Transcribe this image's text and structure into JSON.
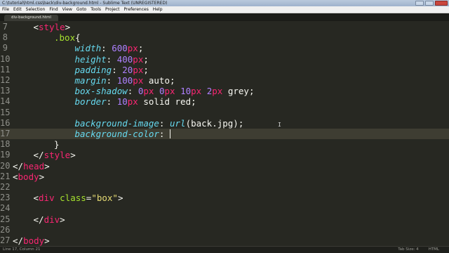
{
  "window": {
    "title": "C:\\tutorial\\html.css\\back\\div-background.html - Sublime Text (UNREGISTERED)"
  },
  "menu": [
    "File",
    "Edit",
    "Selection",
    "Find",
    "View",
    "Goto",
    "Tools",
    "Project",
    "Preferences",
    "Help"
  ],
  "tab": {
    "label": "div-background.html"
  },
  "code": {
    "lines": [
      {
        "num": "7",
        "indent": 1,
        "tokens": [
          {
            "t": "<",
            "c": "punc"
          },
          {
            "t": "style",
            "c": "tag"
          },
          {
            "t": ">",
            "c": "punc"
          }
        ]
      },
      {
        "num": "8",
        "indent": 2,
        "tokens": [
          {
            "t": ".box",
            "c": "sel"
          },
          {
            "t": "{",
            "c": "punc"
          }
        ]
      },
      {
        "num": "9",
        "indent": 3,
        "tokens": [
          {
            "t": "width",
            "c": "prop"
          },
          {
            "t": ": ",
            "c": "punc"
          },
          {
            "t": "600",
            "c": "num"
          },
          {
            "t": "px",
            "c": "unit"
          },
          {
            "t": ";",
            "c": "punc"
          }
        ]
      },
      {
        "num": "10",
        "indent": 3,
        "tokens": [
          {
            "t": "height",
            "c": "prop"
          },
          {
            "t": ": ",
            "c": "punc"
          },
          {
            "t": "400",
            "c": "num"
          },
          {
            "t": "px",
            "c": "unit"
          },
          {
            "t": ";",
            "c": "punc"
          }
        ]
      },
      {
        "num": "11",
        "indent": 3,
        "tokens": [
          {
            "t": "padding",
            "c": "prop"
          },
          {
            "t": ": ",
            "c": "punc"
          },
          {
            "t": "20",
            "c": "num"
          },
          {
            "t": "px",
            "c": "unit"
          },
          {
            "t": ";",
            "c": "punc"
          }
        ]
      },
      {
        "num": "12",
        "indent": 3,
        "tokens": [
          {
            "t": "margin",
            "c": "prop"
          },
          {
            "t": ": ",
            "c": "punc"
          },
          {
            "t": "100",
            "c": "num"
          },
          {
            "t": "px",
            "c": "unit"
          },
          {
            "t": " auto;",
            "c": "plain"
          }
        ]
      },
      {
        "num": "13",
        "indent": 3,
        "tokens": [
          {
            "t": "box-shadow",
            "c": "prop"
          },
          {
            "t": ": ",
            "c": "punc"
          },
          {
            "t": "0",
            "c": "num"
          },
          {
            "t": "px",
            "c": "unit"
          },
          {
            "t": " ",
            "c": "punc"
          },
          {
            "t": "0",
            "c": "num"
          },
          {
            "t": "px",
            "c": "unit"
          },
          {
            "t": " ",
            "c": "punc"
          },
          {
            "t": "10",
            "c": "num"
          },
          {
            "t": "px",
            "c": "unit"
          },
          {
            "t": " ",
            "c": "punc"
          },
          {
            "t": "2",
            "c": "num"
          },
          {
            "t": "px",
            "c": "unit"
          },
          {
            "t": " grey;",
            "c": "plain"
          }
        ]
      },
      {
        "num": "14",
        "indent": 3,
        "tokens": [
          {
            "t": "border",
            "c": "prop"
          },
          {
            "t": ": ",
            "c": "punc"
          },
          {
            "t": "10",
            "c": "num"
          },
          {
            "t": "px",
            "c": "unit"
          },
          {
            "t": " solid red;",
            "c": "plain"
          }
        ]
      },
      {
        "num": "15",
        "indent": 0,
        "tokens": []
      },
      {
        "num": "16",
        "indent": 3,
        "tokens": [
          {
            "t": "background-image",
            "c": "prop"
          },
          {
            "t": ": ",
            "c": "punc"
          },
          {
            "t": "url",
            "c": "prop"
          },
          {
            "t": "(back.jpg);",
            "c": "plain"
          }
        ]
      },
      {
        "num": "17",
        "indent": 3,
        "current": true,
        "caret": true,
        "tokens": [
          {
            "t": "background-color",
            "c": "prop"
          },
          {
            "t": ": ",
            "c": "punc"
          }
        ]
      },
      {
        "num": "18",
        "indent": 2,
        "tokens": [
          {
            "t": "}",
            "c": "punc"
          }
        ]
      },
      {
        "num": "19",
        "indent": 1,
        "tokens": [
          {
            "t": "</",
            "c": "punc"
          },
          {
            "t": "style",
            "c": "tag"
          },
          {
            "t": ">",
            "c": "punc"
          }
        ]
      },
      {
        "num": "20",
        "indent": 0,
        "tokens": [
          {
            "t": "</",
            "c": "punc"
          },
          {
            "t": "head",
            "c": "tag"
          },
          {
            "t": ">",
            "c": "punc"
          }
        ]
      },
      {
        "num": "21",
        "indent": 0,
        "tokens": [
          {
            "t": "<",
            "c": "punc"
          },
          {
            "t": "body",
            "c": "tag"
          },
          {
            "t": ">",
            "c": "punc"
          }
        ]
      },
      {
        "num": "22",
        "indent": 0,
        "tokens": []
      },
      {
        "num": "23",
        "indent": 1,
        "tokens": [
          {
            "t": "<",
            "c": "punc"
          },
          {
            "t": "div",
            "c": "tag"
          },
          {
            "t": " ",
            "c": "punc"
          },
          {
            "t": "class",
            "c": "attr"
          },
          {
            "t": "=",
            "c": "punc"
          },
          {
            "t": "\"box\"",
            "c": "str"
          },
          {
            "t": ">",
            "c": "punc"
          }
        ]
      },
      {
        "num": "24",
        "indent": 0,
        "tokens": []
      },
      {
        "num": "25",
        "indent": 1,
        "tokens": [
          {
            "t": "</",
            "c": "punc"
          },
          {
            "t": "div",
            "c": "tag"
          },
          {
            "t": ">",
            "c": "punc"
          }
        ]
      },
      {
        "num": "26",
        "indent": 0,
        "tokens": []
      },
      {
        "num": "27",
        "indent": 0,
        "tokens": [
          {
            "t": "</",
            "c": "punc"
          },
          {
            "t": "body",
            "c": "tag"
          },
          {
            "t": ">",
            "c": "punc"
          }
        ]
      }
    ]
  },
  "status": {
    "position": "Line 17, Column 21",
    "tab_size": "Tab Size: 4",
    "syntax": "HTML"
  },
  "colors": {
    "background": "#272822",
    "tag": "#f92672",
    "property": "#66d9ef",
    "number": "#ae81ff",
    "selector": "#a6e22e",
    "string": "#e6db74"
  },
  "icons": {
    "mouse": "i-beam-cursor-icon"
  }
}
